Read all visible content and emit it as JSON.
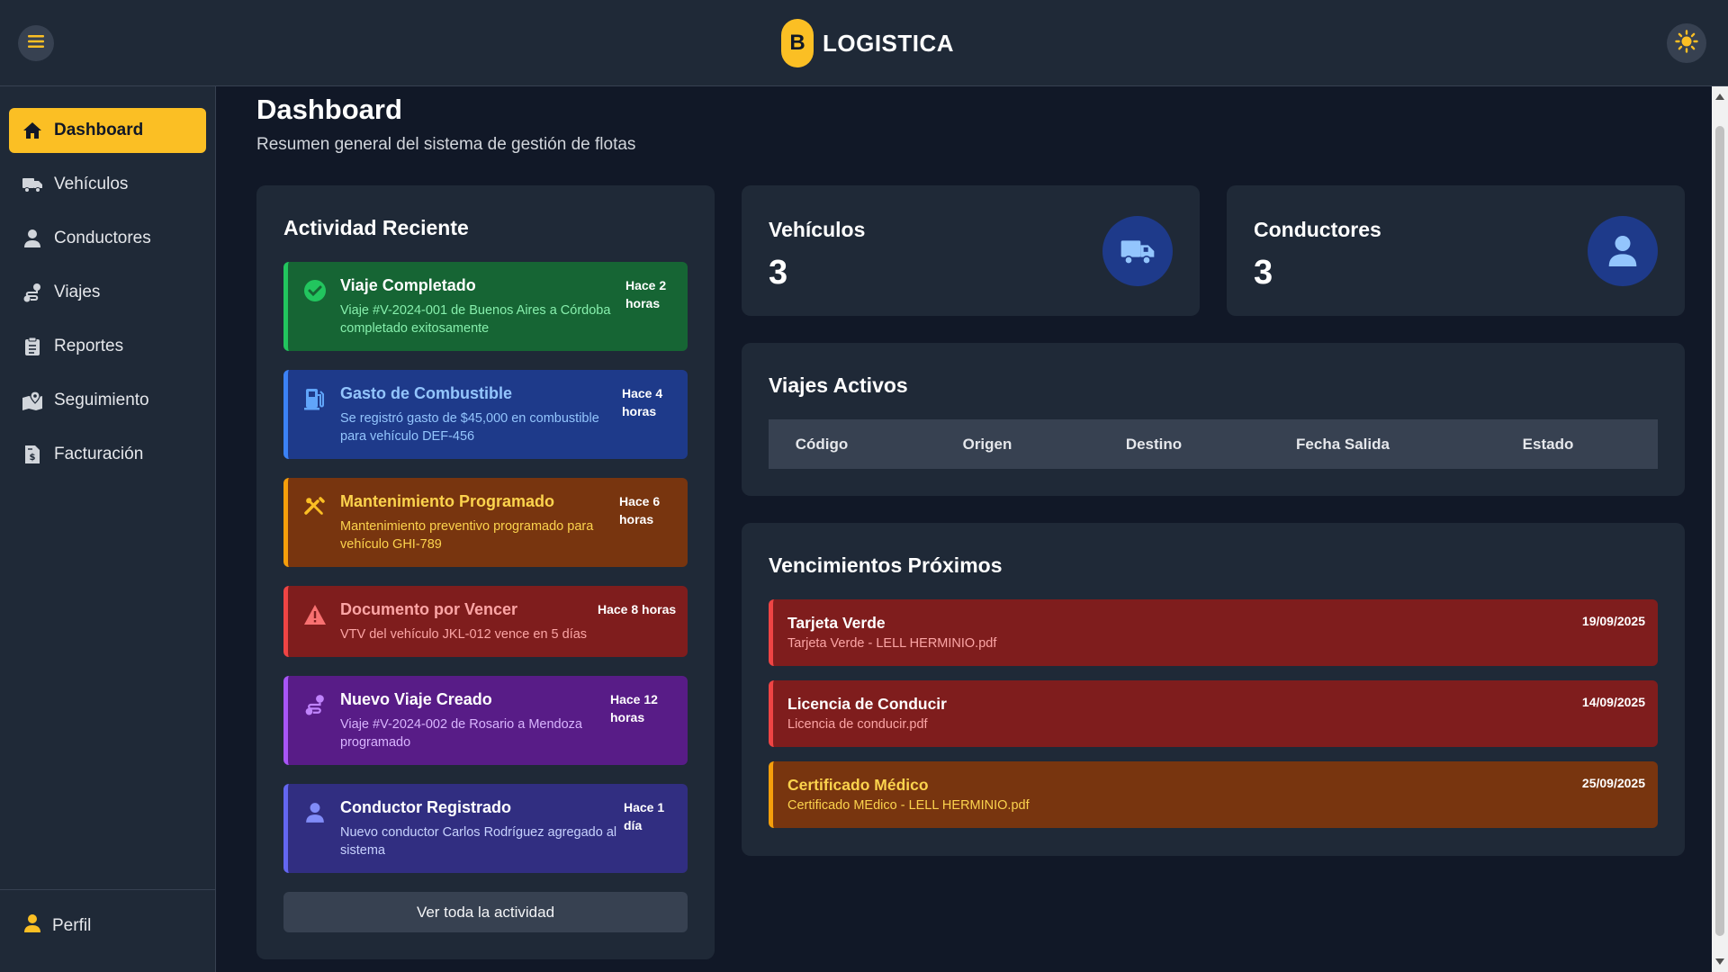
{
  "header": {
    "logo_letter": "B",
    "app_name": "LOGISTICA",
    "menu_icon": "hamburger-icon",
    "theme_icon": "sun-icon",
    "accent": "#fbbf24"
  },
  "sidebar": {
    "items": [
      {
        "label": "Dashboard",
        "icon": "home-icon",
        "active": true
      },
      {
        "label": "Vehículos",
        "icon": "truck-icon"
      },
      {
        "label": "Conductores",
        "icon": "user-icon"
      },
      {
        "label": "Viajes",
        "icon": "route-icon"
      },
      {
        "label": "Reportes",
        "icon": "clipboard-icon"
      },
      {
        "label": "Seguimiento",
        "icon": "map-pin-icon"
      },
      {
        "label": "Facturación",
        "icon": "invoice-icon"
      }
    ],
    "profile": {
      "label": "Perfil",
      "icon": "user-icon"
    }
  },
  "page": {
    "title": "Dashboard",
    "subtitle": "Resumen general del sistema de gestión de flotas"
  },
  "activity": {
    "title": "Actividad Reciente",
    "items": [
      {
        "title": "Viaje Completado",
        "desc": "Viaje #V-2024-001 de Buenos Aires a Córdoba completado exitosamente",
        "time": "Hace 2 horas",
        "icon": "check-circle-icon"
      },
      {
        "title": "Gasto de Combustible",
        "desc": "Se registró gasto de $45,000 en combustible para vehículo DEF-456",
        "time": "Hace 4 horas",
        "icon": "gas-pump-icon"
      },
      {
        "title": "Mantenimiento Programado",
        "desc": "Mantenimiento preventivo programado para vehículo GHI-789",
        "time": "Hace 6 horas",
        "icon": "tools-icon"
      },
      {
        "title": "Documento por Vencer",
        "desc": "VTV del vehículo JKL-012 vence en 5 días",
        "time": "Hace 8 horas",
        "icon": "warning-icon"
      },
      {
        "title": "Nuevo Viaje Creado",
        "desc": "Viaje #V-2024-002 de Rosario a Mendoza programado",
        "time": "Hace 12 horas",
        "icon": "route-icon"
      },
      {
        "title": "Conductor Registrado",
        "desc": "Nuevo conductor Carlos Rodríguez agregado al sistema",
        "time": "Hace 1 día",
        "icon": "user-icon"
      }
    ],
    "see_all": "Ver toda la actividad"
  },
  "stats": {
    "vehicles": {
      "label": "Vehículos",
      "value": "3",
      "icon": "truck-icon"
    },
    "drivers": {
      "label": "Conductores",
      "value": "3",
      "icon": "user-icon"
    }
  },
  "trips": {
    "title": "Viajes Activos",
    "columns": [
      "Código",
      "Origen",
      "Destino",
      "Fecha Salida",
      "Estado"
    ]
  },
  "expirations": {
    "title": "Vencimientos Próximos",
    "items": [
      {
        "title": "Tarjeta Verde",
        "file": "Tarjeta Verde - LELL HERMINIO.pdf",
        "date": "19/09/2025",
        "status": "red"
      },
      {
        "title": "Licencia de Conducir",
        "file": "Licencia de conducir.pdf",
        "date": "14/09/2025",
        "status": "red"
      },
      {
        "title": "Certificado Médico",
        "file": "Certificado MEdico - LELL HERMINIO.pdf",
        "date": "25/09/2025",
        "status": "orange"
      }
    ]
  }
}
